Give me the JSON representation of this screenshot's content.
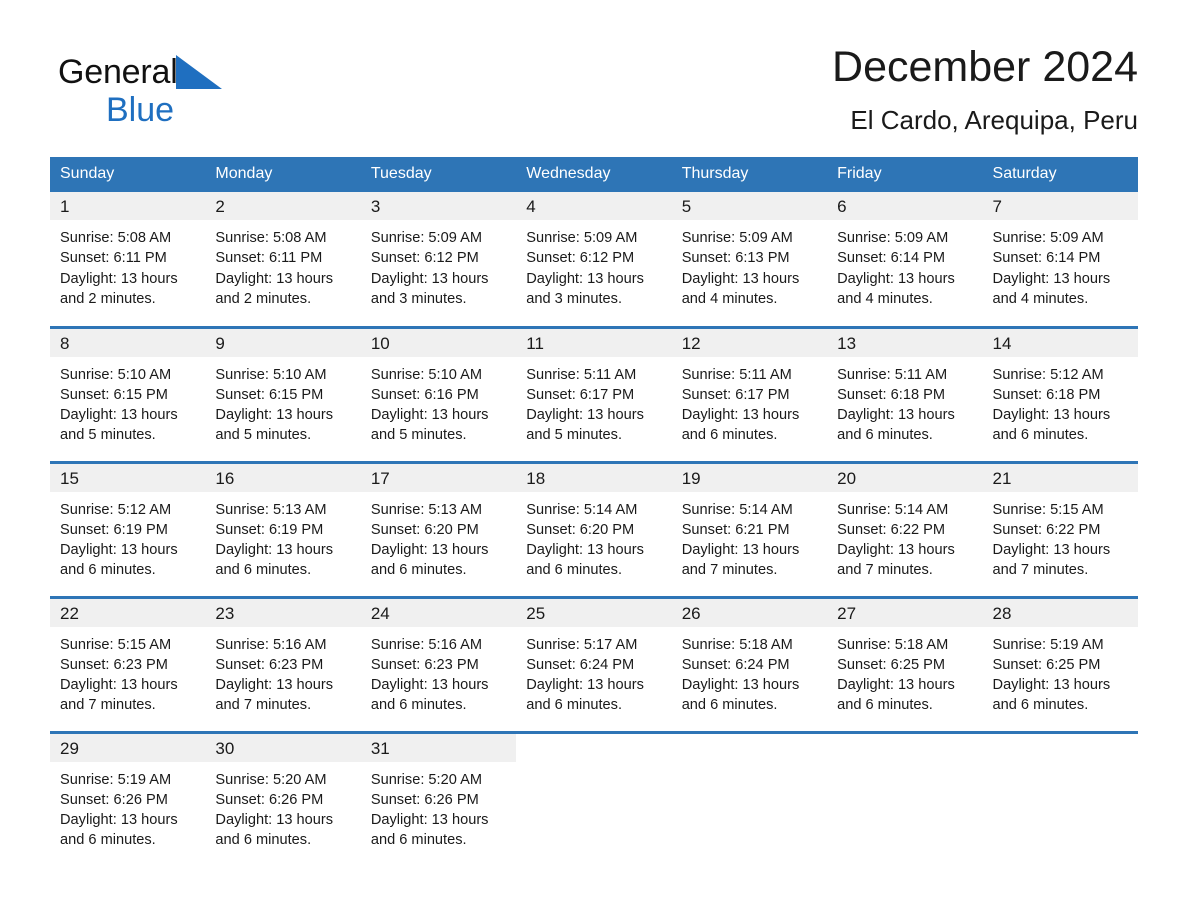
{
  "brand": {
    "name_top": "General",
    "name_bottom": "Blue",
    "triangle_color": "#1f6fc0",
    "text_color": "#111111",
    "blue_color": "#1f6fc0"
  },
  "header": {
    "title": "December 2024",
    "subtitle": "El Cardo, Arequipa, Peru"
  },
  "colors": {
    "header_blue": "#2e75b6",
    "day_band_gray": "#f0f0f0",
    "text": "#1a1a1a"
  },
  "weekdays": [
    "Sunday",
    "Monday",
    "Tuesday",
    "Wednesday",
    "Thursday",
    "Friday",
    "Saturday"
  ],
  "weeks": [
    [
      {
        "day": "1",
        "sunrise": "Sunrise: 5:08 AM",
        "sunset": "Sunset: 6:11 PM",
        "daylight_line1": "Daylight: 13 hours",
        "daylight_line2": "and 2 minutes."
      },
      {
        "day": "2",
        "sunrise": "Sunrise: 5:08 AM",
        "sunset": "Sunset: 6:11 PM",
        "daylight_line1": "Daylight: 13 hours",
        "daylight_line2": "and 2 minutes."
      },
      {
        "day": "3",
        "sunrise": "Sunrise: 5:09 AM",
        "sunset": "Sunset: 6:12 PM",
        "daylight_line1": "Daylight: 13 hours",
        "daylight_line2": "and 3 minutes."
      },
      {
        "day": "4",
        "sunrise": "Sunrise: 5:09 AM",
        "sunset": "Sunset: 6:12 PM",
        "daylight_line1": "Daylight: 13 hours",
        "daylight_line2": "and 3 minutes."
      },
      {
        "day": "5",
        "sunrise": "Sunrise: 5:09 AM",
        "sunset": "Sunset: 6:13 PM",
        "daylight_line1": "Daylight: 13 hours",
        "daylight_line2": "and 4 minutes."
      },
      {
        "day": "6",
        "sunrise": "Sunrise: 5:09 AM",
        "sunset": "Sunset: 6:14 PM",
        "daylight_line1": "Daylight: 13 hours",
        "daylight_line2": "and 4 minutes."
      },
      {
        "day": "7",
        "sunrise": "Sunrise: 5:09 AM",
        "sunset": "Sunset: 6:14 PM",
        "daylight_line1": "Daylight: 13 hours",
        "daylight_line2": "and 4 minutes."
      }
    ],
    [
      {
        "day": "8",
        "sunrise": "Sunrise: 5:10 AM",
        "sunset": "Sunset: 6:15 PM",
        "daylight_line1": "Daylight: 13 hours",
        "daylight_line2": "and 5 minutes."
      },
      {
        "day": "9",
        "sunrise": "Sunrise: 5:10 AM",
        "sunset": "Sunset: 6:15 PM",
        "daylight_line1": "Daylight: 13 hours",
        "daylight_line2": "and 5 minutes."
      },
      {
        "day": "10",
        "sunrise": "Sunrise: 5:10 AM",
        "sunset": "Sunset: 6:16 PM",
        "daylight_line1": "Daylight: 13 hours",
        "daylight_line2": "and 5 minutes."
      },
      {
        "day": "11",
        "sunrise": "Sunrise: 5:11 AM",
        "sunset": "Sunset: 6:17 PM",
        "daylight_line1": "Daylight: 13 hours",
        "daylight_line2": "and 5 minutes."
      },
      {
        "day": "12",
        "sunrise": "Sunrise: 5:11 AM",
        "sunset": "Sunset: 6:17 PM",
        "daylight_line1": "Daylight: 13 hours",
        "daylight_line2": "and 6 minutes."
      },
      {
        "day": "13",
        "sunrise": "Sunrise: 5:11 AM",
        "sunset": "Sunset: 6:18 PM",
        "daylight_line1": "Daylight: 13 hours",
        "daylight_line2": "and 6 minutes."
      },
      {
        "day": "14",
        "sunrise": "Sunrise: 5:12 AM",
        "sunset": "Sunset: 6:18 PM",
        "daylight_line1": "Daylight: 13 hours",
        "daylight_line2": "and 6 minutes."
      }
    ],
    [
      {
        "day": "15",
        "sunrise": "Sunrise: 5:12 AM",
        "sunset": "Sunset: 6:19 PM",
        "daylight_line1": "Daylight: 13 hours",
        "daylight_line2": "and 6 minutes."
      },
      {
        "day": "16",
        "sunrise": "Sunrise: 5:13 AM",
        "sunset": "Sunset: 6:19 PM",
        "daylight_line1": "Daylight: 13 hours",
        "daylight_line2": "and 6 minutes."
      },
      {
        "day": "17",
        "sunrise": "Sunrise: 5:13 AM",
        "sunset": "Sunset: 6:20 PM",
        "daylight_line1": "Daylight: 13 hours",
        "daylight_line2": "and 6 minutes."
      },
      {
        "day": "18",
        "sunrise": "Sunrise: 5:14 AM",
        "sunset": "Sunset: 6:20 PM",
        "daylight_line1": "Daylight: 13 hours",
        "daylight_line2": "and 6 minutes."
      },
      {
        "day": "19",
        "sunrise": "Sunrise: 5:14 AM",
        "sunset": "Sunset: 6:21 PM",
        "daylight_line1": "Daylight: 13 hours",
        "daylight_line2": "and 7 minutes."
      },
      {
        "day": "20",
        "sunrise": "Sunrise: 5:14 AM",
        "sunset": "Sunset: 6:22 PM",
        "daylight_line1": "Daylight: 13 hours",
        "daylight_line2": "and 7 minutes."
      },
      {
        "day": "21",
        "sunrise": "Sunrise: 5:15 AM",
        "sunset": "Sunset: 6:22 PM",
        "daylight_line1": "Daylight: 13 hours",
        "daylight_line2": "and 7 minutes."
      }
    ],
    [
      {
        "day": "22",
        "sunrise": "Sunrise: 5:15 AM",
        "sunset": "Sunset: 6:23 PM",
        "daylight_line1": "Daylight: 13 hours",
        "daylight_line2": "and 7 minutes."
      },
      {
        "day": "23",
        "sunrise": "Sunrise: 5:16 AM",
        "sunset": "Sunset: 6:23 PM",
        "daylight_line1": "Daylight: 13 hours",
        "daylight_line2": "and 7 minutes."
      },
      {
        "day": "24",
        "sunrise": "Sunrise: 5:16 AM",
        "sunset": "Sunset: 6:23 PM",
        "daylight_line1": "Daylight: 13 hours",
        "daylight_line2": "and 6 minutes."
      },
      {
        "day": "25",
        "sunrise": "Sunrise: 5:17 AM",
        "sunset": "Sunset: 6:24 PM",
        "daylight_line1": "Daylight: 13 hours",
        "daylight_line2": "and 6 minutes."
      },
      {
        "day": "26",
        "sunrise": "Sunrise: 5:18 AM",
        "sunset": "Sunset: 6:24 PM",
        "daylight_line1": "Daylight: 13 hours",
        "daylight_line2": "and 6 minutes."
      },
      {
        "day": "27",
        "sunrise": "Sunrise: 5:18 AM",
        "sunset": "Sunset: 6:25 PM",
        "daylight_line1": "Daylight: 13 hours",
        "daylight_line2": "and 6 minutes."
      },
      {
        "day": "28",
        "sunrise": "Sunrise: 5:19 AM",
        "sunset": "Sunset: 6:25 PM",
        "daylight_line1": "Daylight: 13 hours",
        "daylight_line2": "and 6 minutes."
      }
    ],
    [
      {
        "day": "29",
        "sunrise": "Sunrise: 5:19 AM",
        "sunset": "Sunset: 6:26 PM",
        "daylight_line1": "Daylight: 13 hours",
        "daylight_line2": "and 6 minutes."
      },
      {
        "day": "30",
        "sunrise": "Sunrise: 5:20 AM",
        "sunset": "Sunset: 6:26 PM",
        "daylight_line1": "Daylight: 13 hours",
        "daylight_line2": "and 6 minutes."
      },
      {
        "day": "31",
        "sunrise": "Sunrise: 5:20 AM",
        "sunset": "Sunset: 6:26 PM",
        "daylight_line1": "Daylight: 13 hours",
        "daylight_line2": "and 6 minutes."
      },
      {
        "day": "",
        "sunrise": "",
        "sunset": "",
        "daylight_line1": "",
        "daylight_line2": ""
      },
      {
        "day": "",
        "sunrise": "",
        "sunset": "",
        "daylight_line1": "",
        "daylight_line2": ""
      },
      {
        "day": "",
        "sunrise": "",
        "sunset": "",
        "daylight_line1": "",
        "daylight_line2": ""
      },
      {
        "day": "",
        "sunrise": "",
        "sunset": "",
        "daylight_line1": "",
        "daylight_line2": ""
      }
    ]
  ]
}
